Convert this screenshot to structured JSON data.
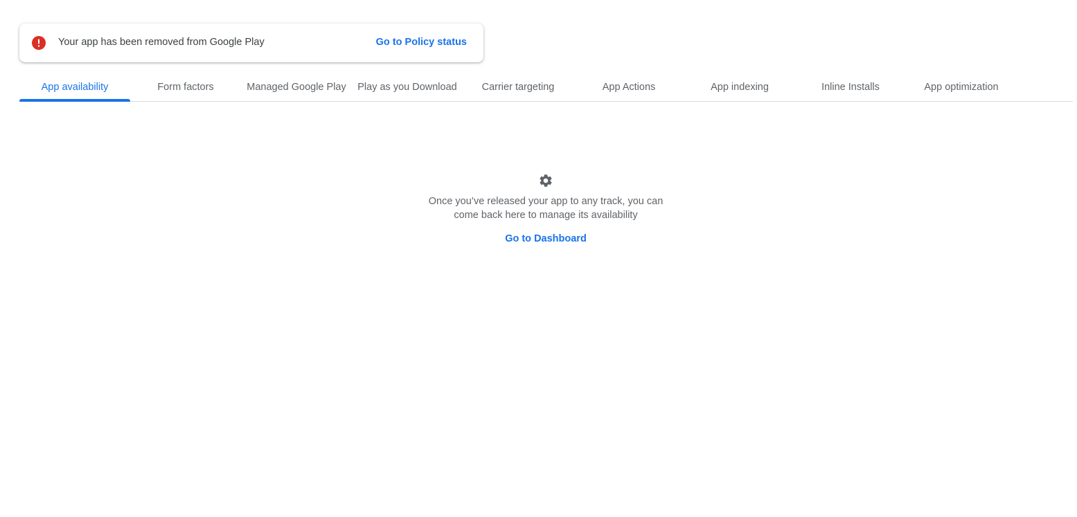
{
  "alert": {
    "icon": "error-icon",
    "message": "Your app has been removed from Google Play",
    "action_label": "Go to Policy status",
    "icon_color": "#d93025",
    "link_color": "#1a73e8"
  },
  "tabs": [
    {
      "label": "App availability",
      "active": true
    },
    {
      "label": "Form factors",
      "active": false
    },
    {
      "label": "Managed Google Play",
      "active": false
    },
    {
      "label": "Play as you Download",
      "active": false
    },
    {
      "label": "Carrier targeting",
      "active": false
    },
    {
      "label": "App Actions",
      "active": false
    },
    {
      "label": "App indexing",
      "active": false
    },
    {
      "label": "Inline Installs",
      "active": false
    },
    {
      "label": "App optimization",
      "active": false
    }
  ],
  "empty_state": {
    "icon": "gear-icon",
    "line1": "Once you’ve released your app to any track, you can",
    "line2": "come back here to manage its availability",
    "action_label": "Go to Dashboard"
  }
}
